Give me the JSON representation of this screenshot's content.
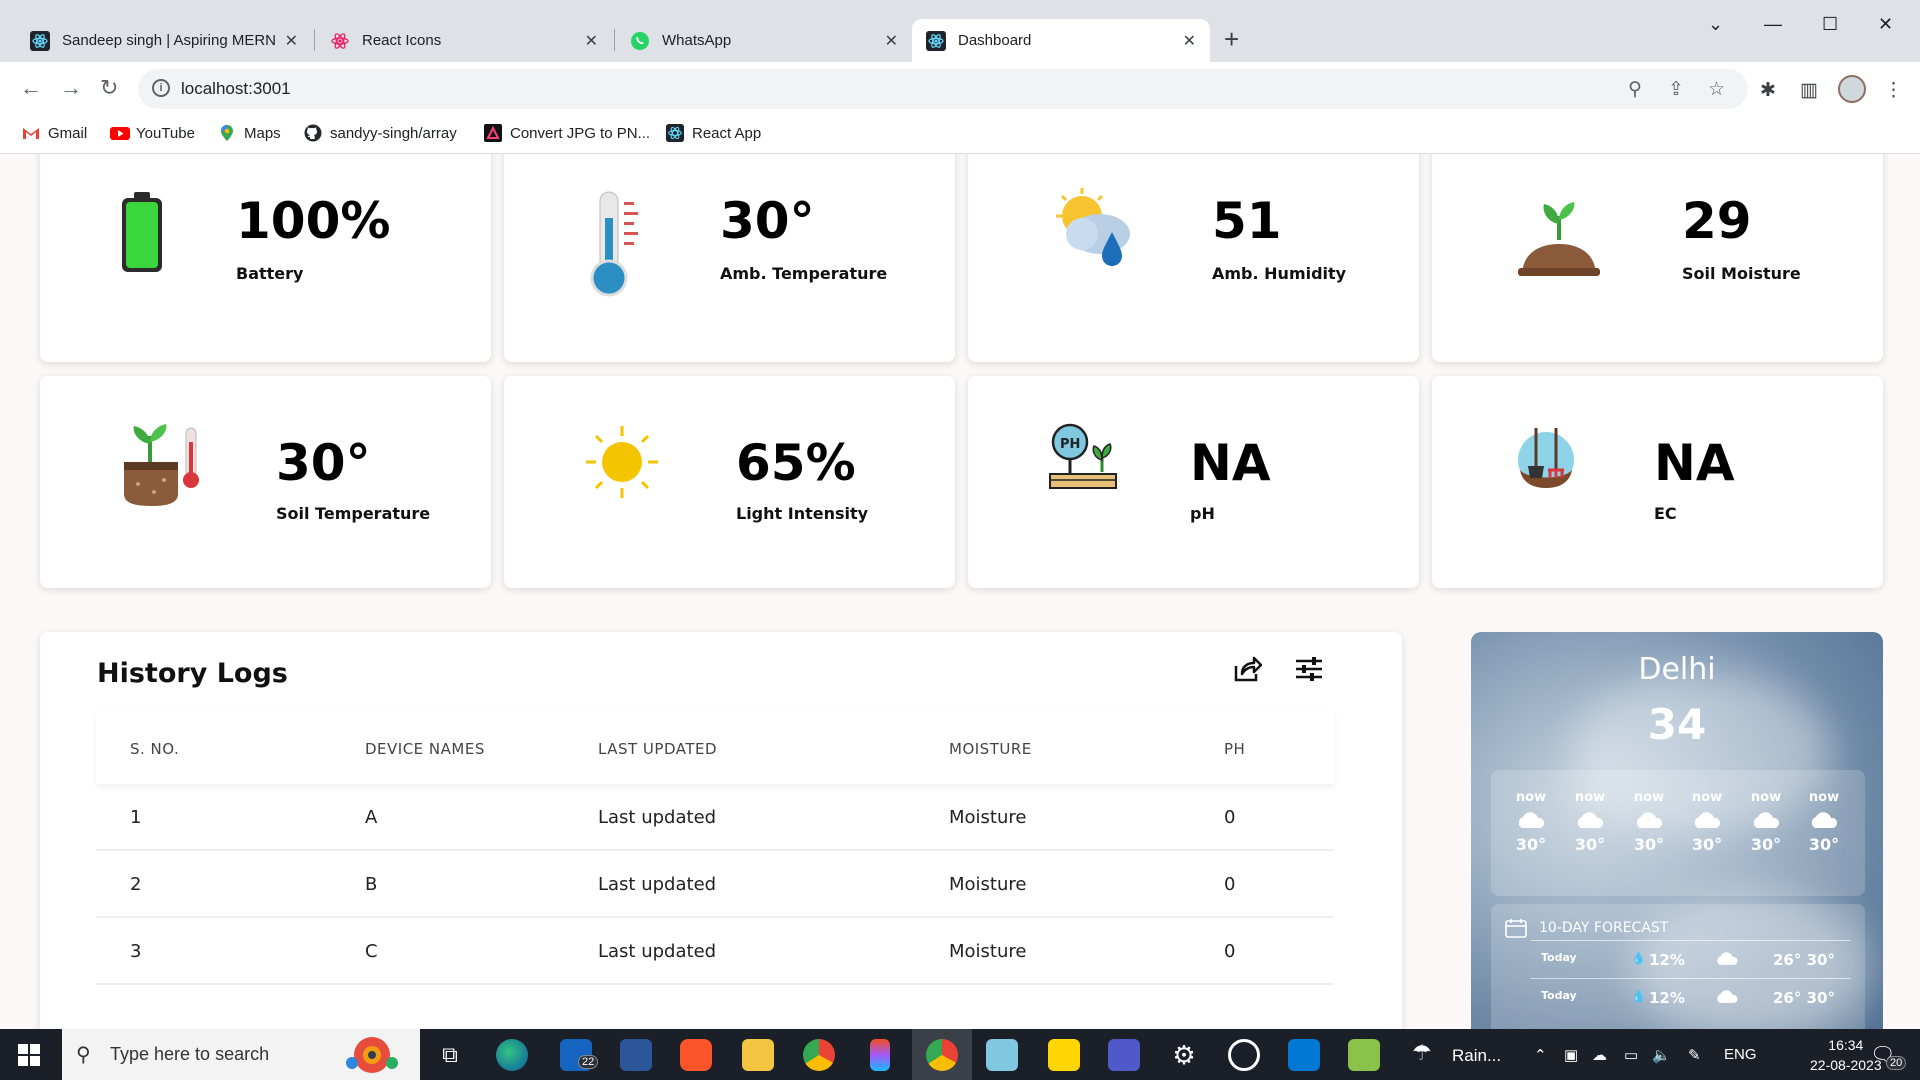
{
  "browser": {
    "tabs": [
      {
        "label": "Sandeep singh | Aspiring MERN S",
        "icon": "react-icon",
        "active": false
      },
      {
        "label": "React Icons",
        "icon": "react-icon",
        "active": false
      },
      {
        "label": "WhatsApp",
        "icon": "whatsapp-icon",
        "active": false
      },
      {
        "label": "Dashboard",
        "icon": "react-icon",
        "active": true
      }
    ],
    "url": "localhost:3001",
    "bookmarks": [
      {
        "label": "Gmail",
        "icon": "gmail-icon"
      },
      {
        "label": "YouTube",
        "icon": "youtube-icon"
      },
      {
        "label": "Maps",
        "icon": "maps-icon"
      },
      {
        "label": "sandyy-singh/array",
        "icon": "github-icon"
      },
      {
        "label": "Convert JPG to PN...",
        "icon": "convert-icon"
      },
      {
        "label": "React App",
        "icon": "react-icon"
      }
    ]
  },
  "cards": [
    {
      "value": "100%",
      "label": "Battery",
      "icon": "battery-icon"
    },
    {
      "value": "30°",
      "label": "Amb. Temperature",
      "icon": "thermometer-icon"
    },
    {
      "value": "51",
      "label": "Amb. Humidity",
      "icon": "humidity-icon"
    },
    {
      "value": "29",
      "label": "Soil Moisture",
      "icon": "plant-soil-icon"
    },
    {
      "value": "30°",
      "label": "Soil Temperature",
      "icon": "soil-temperature-icon"
    },
    {
      "value": "65%",
      "label": "Light Intensity",
      "icon": "sun-icon"
    },
    {
      "value": "NA",
      "label": "pH",
      "icon": "ph-meter-icon"
    },
    {
      "value": "NA",
      "label": "EC",
      "icon": "ec-tools-icon"
    }
  ],
  "history": {
    "title": "History Logs",
    "columns": [
      "S. NO.",
      "DEVICE NAMES",
      "LAST UPDATED",
      "MOISTURE",
      "PH"
    ],
    "rows": [
      [
        "1",
        "A",
        "Last updated",
        "Moisture",
        "0"
      ],
      [
        "2",
        "B",
        "Last updated",
        "Moisture",
        "0"
      ],
      [
        "3",
        "C",
        "Last updated",
        "Moisture",
        "0"
      ]
    ]
  },
  "weather": {
    "city": "Delhi",
    "temp": "34",
    "hourly": [
      {
        "time": "now",
        "temp": "30°"
      },
      {
        "time": "now",
        "temp": "30°"
      },
      {
        "time": "now",
        "temp": "30°"
      },
      {
        "time": "now",
        "temp": "30°"
      },
      {
        "time": "now",
        "temp": "30°"
      },
      {
        "time": "now",
        "temp": "30°"
      }
    ],
    "forecast_title": "10-DAY FORECAST",
    "forecast": [
      {
        "day": "Today",
        "rain": "12%",
        "range": "26° 30°"
      },
      {
        "day": "Today",
        "rain": "12%",
        "range": "26° 30°"
      }
    ]
  },
  "taskbar": {
    "search_placeholder": "Type here to search",
    "mail_badge": "22",
    "weather_text": "Rain...",
    "language": "ENG",
    "time": "16:34",
    "date": "22-08-2023",
    "notifications": "20"
  }
}
